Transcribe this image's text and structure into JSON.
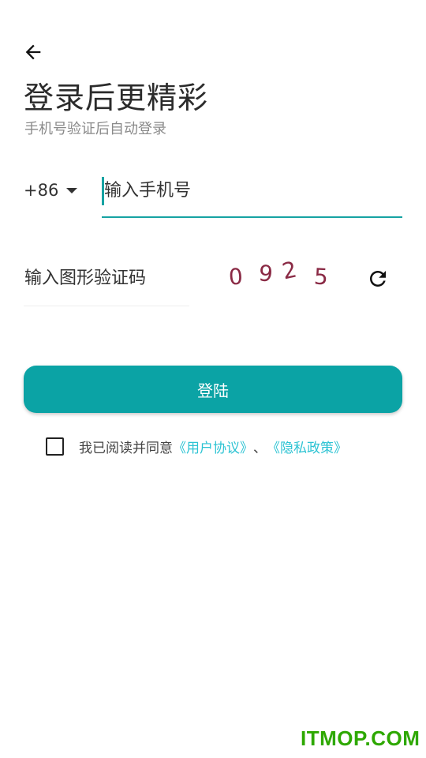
{
  "header": {
    "back_icon": "arrow-left-icon",
    "title": "登录后更精彩",
    "subtitle": "手机号验证后自动登录"
  },
  "phone": {
    "country_code": "+86",
    "dropdown_icon": "caret-down-icon",
    "placeholder": "输入手机号"
  },
  "captcha": {
    "placeholder": "输入图形验证码",
    "chars": [
      "0",
      "9",
      "2",
      "5"
    ],
    "refresh_icon": "refresh-icon"
  },
  "login_button": {
    "label": "登陆"
  },
  "agreement": {
    "checked": false,
    "prefix": "我已阅读并同意",
    "user_agreement": "《用户协议》",
    "separator": "、",
    "privacy_policy": "《隐私政策》"
  },
  "watermark": {
    "text": "ITMOP.COM"
  },
  "colors": {
    "accent": "#0ba3a5",
    "link": "#2cc3d3",
    "captcha": "#8a2a45",
    "watermark": "#2ea800"
  }
}
